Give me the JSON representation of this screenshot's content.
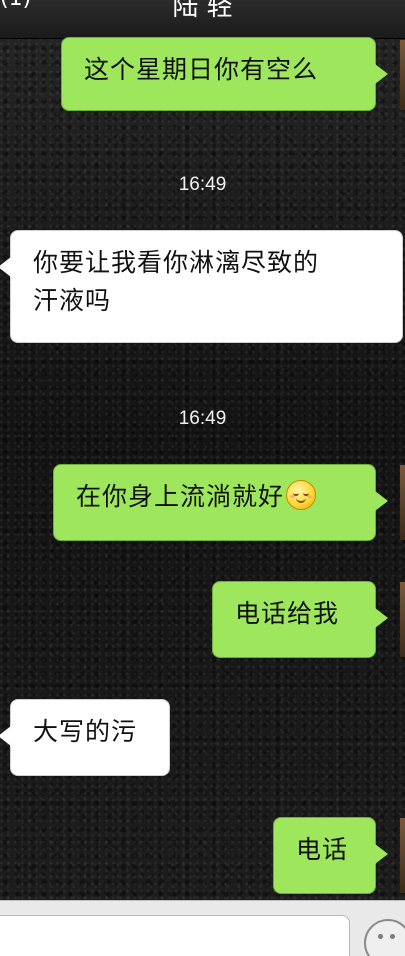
{
  "nav": {
    "back_label": "(1)",
    "title": "陆 轻"
  },
  "messages": [
    {
      "direction": "out",
      "text": "这个星期日你有空么"
    },
    {
      "timestamp": "16:49"
    },
    {
      "direction": "in",
      "text_line1": "你要让我看你淋漓尽致的",
      "text_line2": "汗液吗"
    },
    {
      "timestamp": "16:49"
    },
    {
      "direction": "out",
      "text": "在你身上流淌就好",
      "emoji": "smile-blush-emoji"
    },
    {
      "direction": "out",
      "text": "电话给我"
    },
    {
      "direction": "in",
      "text": "大写的污"
    },
    {
      "direction": "out",
      "text": "电话"
    }
  ],
  "input": {
    "placeholder": "",
    "value": ""
  },
  "icons": {
    "emoji_button": "smiley-face-icon"
  },
  "colors": {
    "outgoing_bubble": "#9ee65c",
    "incoming_bubble": "#ffffff",
    "timestamp_text": "#f2f2f2"
  }
}
